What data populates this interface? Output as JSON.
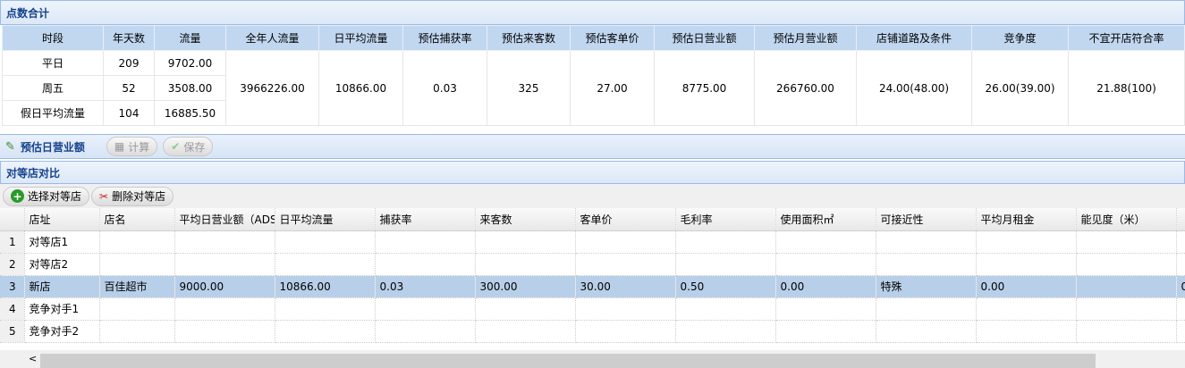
{
  "summary": {
    "title": "点数合计",
    "headers": [
      "时段",
      "年天数",
      "流量",
      "全年人流量",
      "日平均流量",
      "预估捕获率",
      "预估来客数",
      "预估客单价",
      "预估日营业额",
      "预估月营业额",
      "店铺道路及条件",
      "竞争度",
      "不宜开店符合率"
    ],
    "rows": [
      [
        "平日",
        "209",
        "9702.00"
      ],
      [
        "周五",
        "52",
        "3508.00"
      ],
      [
        "假日平均流量",
        "104",
        "16885.50"
      ]
    ],
    "merged": [
      "3966226.00",
      "10866.00",
      "0.03",
      "325",
      "27.00",
      "8775.00",
      "266760.00",
      "24.00(48.00)",
      "26.00(39.00)",
      "21.88(100)"
    ]
  },
  "toolbar": {
    "title": "预估日营业额",
    "calc": "计算",
    "save": "保存"
  },
  "compare": {
    "title": "对等店对比",
    "select": "选择对等店",
    "delete": "删除对等店",
    "headers": [
      "店址",
      "店名",
      "平均日营业额（ADS）",
      "日平均流量",
      "捕获率",
      "来客数",
      "客单价",
      "毛利率",
      "使用面积㎡",
      "可接近性",
      "平均月租金",
      "能见度（米）",
      ""
    ],
    "rows": [
      {
        "n": "1",
        "cells": [
          "对等店1",
          "",
          "",
          "",
          "",
          "",
          "",
          "",
          "",
          "",
          "",
          "",
          ""
        ]
      },
      {
        "n": "2",
        "cells": [
          "对等店2",
          "",
          "",
          "",
          "",
          "",
          "",
          "",
          "",
          "",
          "",
          "",
          ""
        ]
      },
      {
        "n": "3",
        "cells": [
          "新店",
          "百佳超市",
          "9000.00",
          "10866.00",
          "0.03",
          "300.00",
          "30.00",
          "0.50",
          "0.00",
          "特殊",
          "0.00",
          "",
          "0"
        ]
      },
      {
        "n": "4",
        "cells": [
          "竞争对手1",
          "",
          "",
          "",
          "",
          "",
          "",
          "",
          "",
          "",
          "",
          "",
          ""
        ]
      },
      {
        "n": "5",
        "cells": [
          "竞争对手2",
          "",
          "",
          "",
          "",
          "",
          "",
          "",
          "",
          "",
          "",
          "",
          ""
        ]
      }
    ]
  },
  "scroll": {
    "left": "<"
  }
}
